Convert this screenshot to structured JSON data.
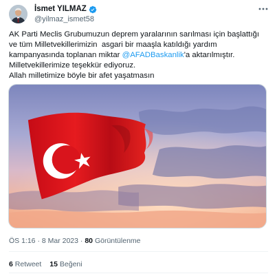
{
  "user": {
    "display_name": "İsmet YILMAZ",
    "handle": "@yilmaz_ismet58"
  },
  "tweet": {
    "text_before_mention": "AK Parti Meclis Grubumuzun deprem yaralarının sarılması için başlattığı\nve tüm Milletvekillerimizin  asgari bir maaşla katıldığı yardım\nkampanyasında toplanan miktar ",
    "mention": "@AFADBaskanlik",
    "text_after_mention": "'a aktarılmıştır.\nMilletvekillerimize teşekkür ediyoruz.\nAllah milletimize böyle bir afet yaşatmasın"
  },
  "meta": {
    "time": "ÖS 1:16",
    "separator": "·",
    "date": "8 Mar 2023",
    "views_count": "80",
    "views_label": "Görüntülenme"
  },
  "stats": {
    "retweets_count": "6",
    "retweets_label": "Retweet",
    "likes_count": "15",
    "likes_label": "Beğeni"
  },
  "icons": {
    "verified": "verified-badge-icon",
    "more": "more-options-icon"
  },
  "colors": {
    "accent": "#1d9bf0",
    "flag_red": "#e30a17",
    "sky_top": "#8b8fc0",
    "sky_bottom": "#f2a98d"
  }
}
